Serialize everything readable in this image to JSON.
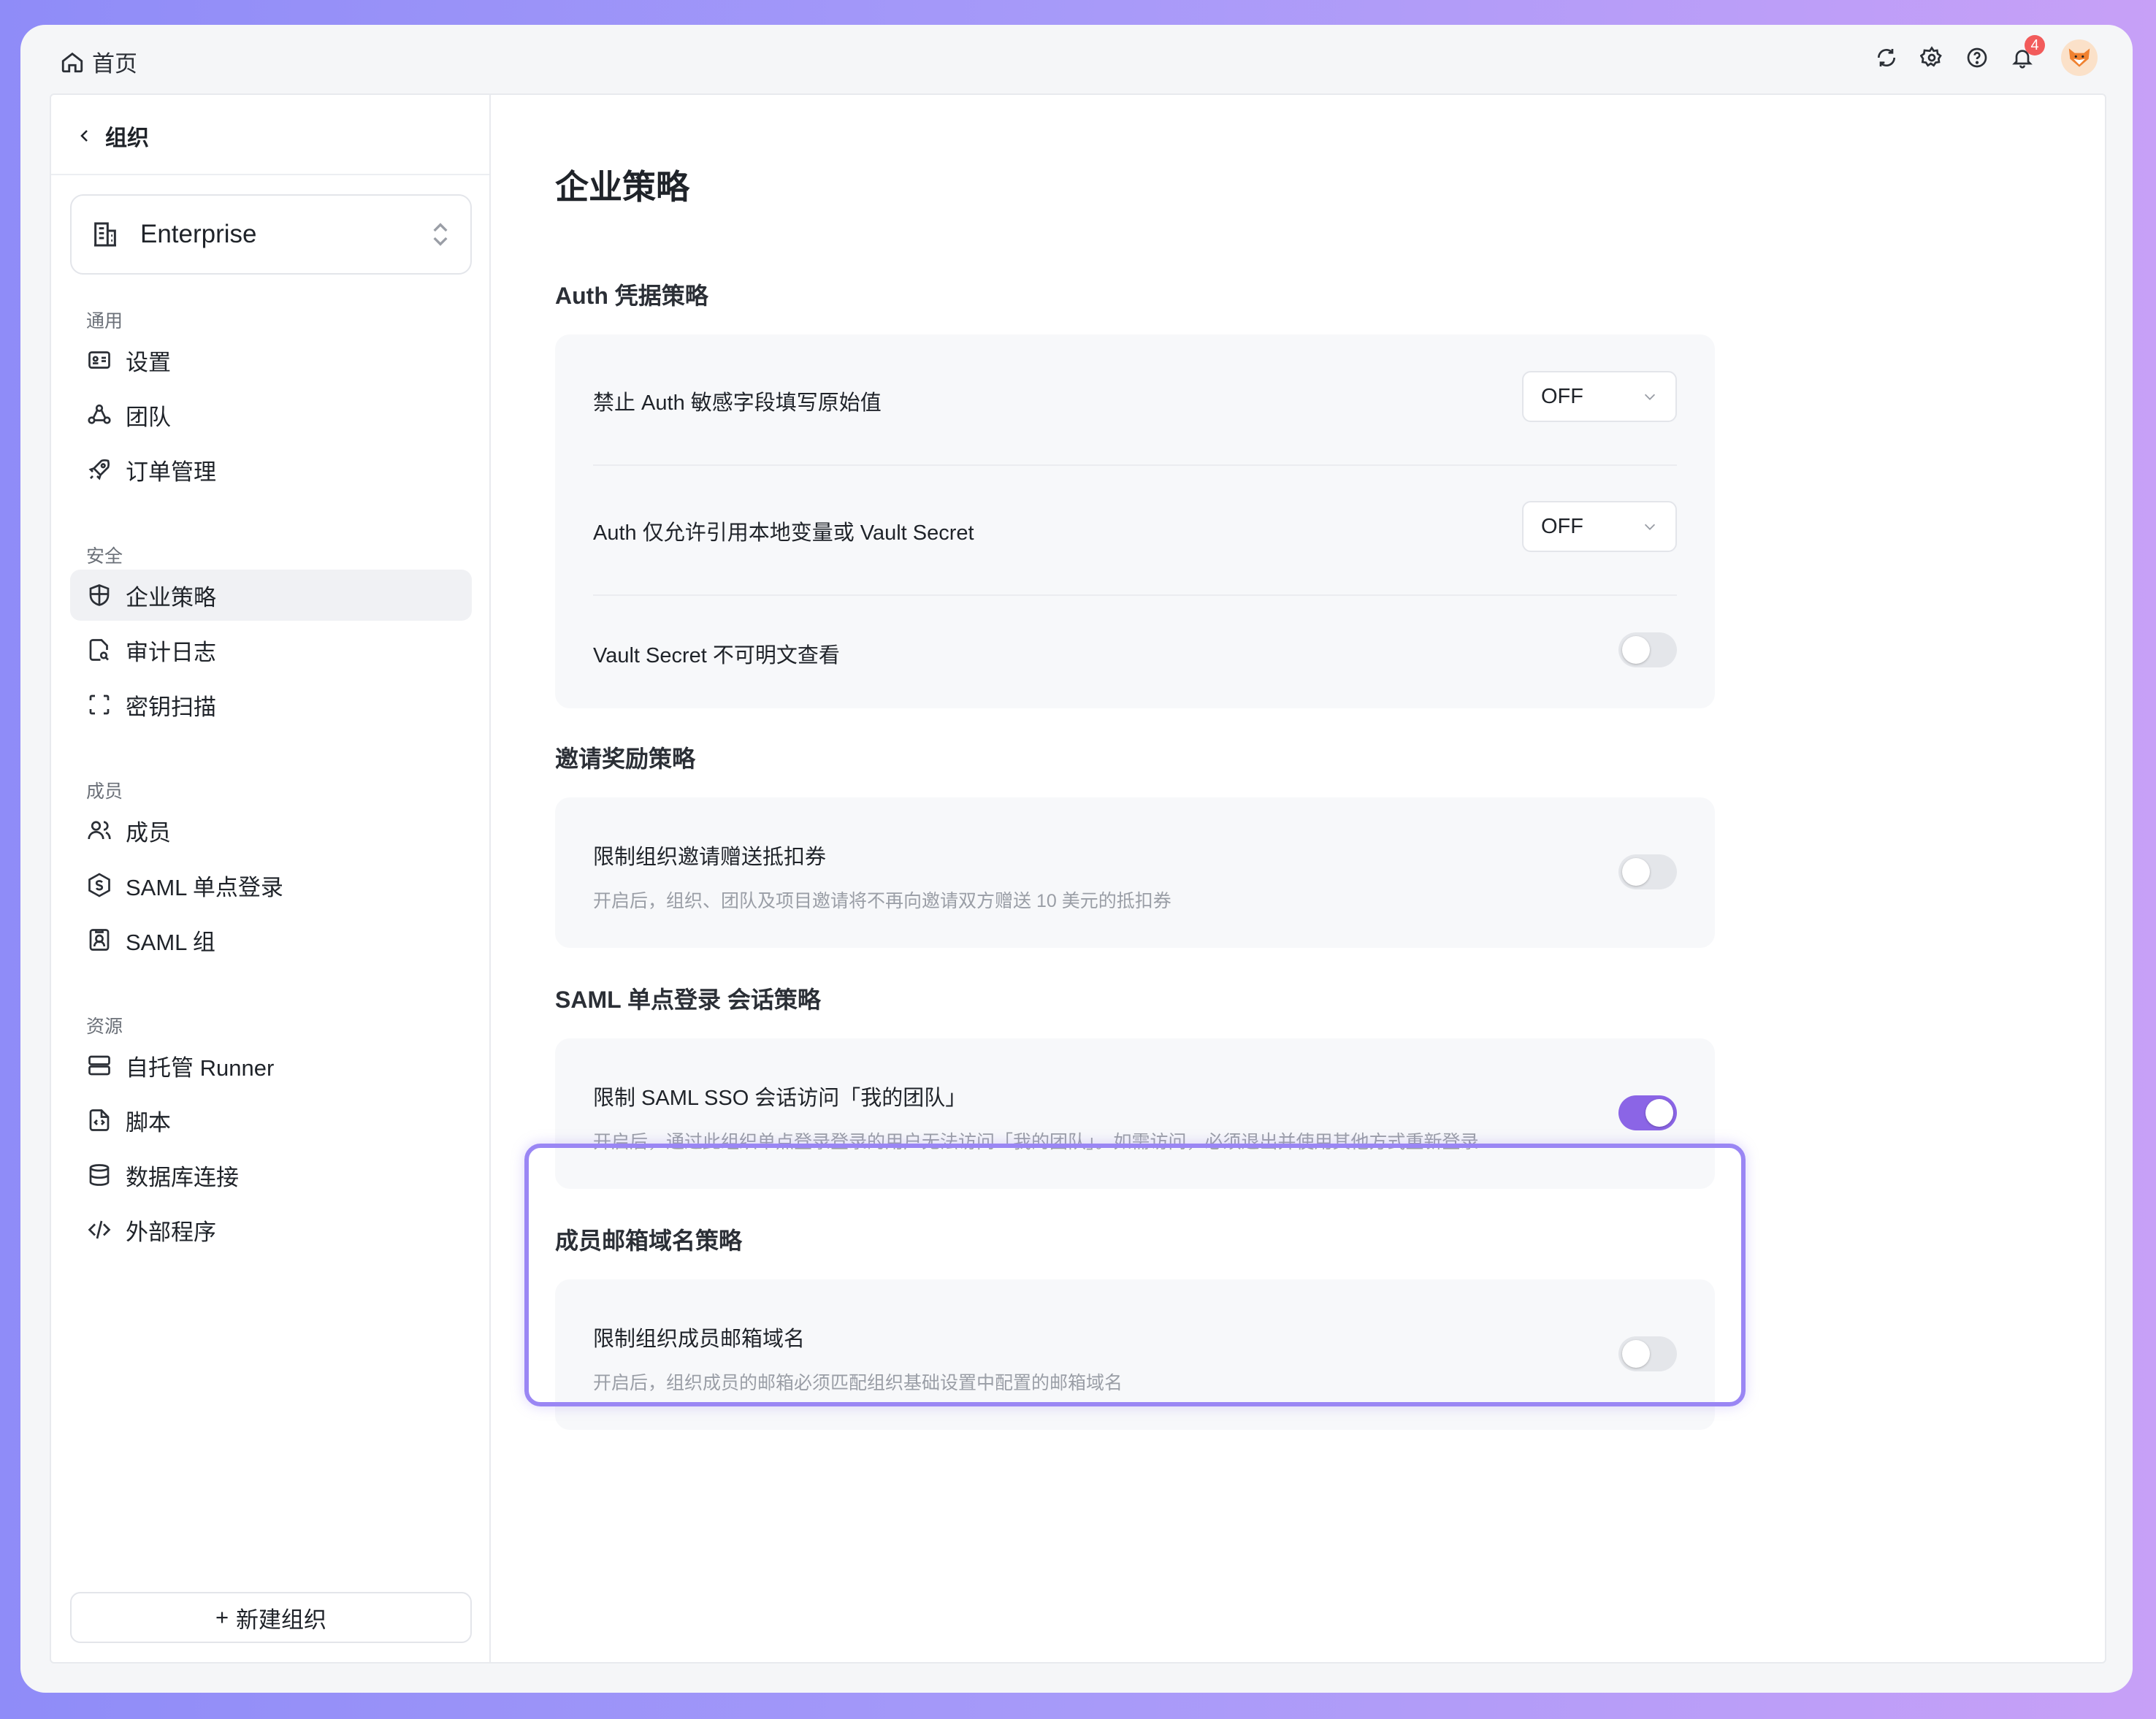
{
  "topbar": {
    "home_label": "首页",
    "notification_count": "4"
  },
  "sidebar": {
    "back_label": "组织",
    "org_name": "Enterprise",
    "sections": {
      "general": "通用",
      "security": "安全",
      "members": "成员",
      "resources": "资源"
    },
    "items": {
      "settings": "设置",
      "team": "团队",
      "orders": "订单管理",
      "policy": "企业策略",
      "audit": "审计日志",
      "secret_scan": "密钥扫描",
      "members": "成员",
      "saml_sso": "SAML 单点登录",
      "saml_group": "SAML 组",
      "runner": "自托管 Runner",
      "scripts": "脚本",
      "db": "数据库连接",
      "external": "外部程序"
    },
    "new_org": "新建组织"
  },
  "content": {
    "title": "企业策略",
    "auth": {
      "title": "Auth 凭据策略",
      "row1_label": "禁止 Auth 敏感字段填写原始值",
      "row1_value": "OFF",
      "row2_label": "Auth 仅允许引用本地变量或 Vault Secret",
      "row2_value": "OFF",
      "row3_label": "Vault Secret 不可明文查看",
      "row3_on": false
    },
    "invite": {
      "title": "邀请奖励策略",
      "label": "限制组织邀请赠送抵扣券",
      "desc": "开启后，组织、团队及项目邀请将不再向邀请双方赠送 10 美元的抵扣券",
      "on": false
    },
    "saml": {
      "title": "SAML 单点登录 会话策略",
      "label": "限制 SAML SSO 会话访问「我的团队」",
      "desc": "开启后，通过此组织单点登录登录的用户无法访问「我的团队」。如需访问，必须退出并使用其他方式重新登录",
      "on": true
    },
    "email": {
      "title": "成员邮箱域名策略",
      "label": "限制组织成员邮箱域名",
      "desc": "开启后，组织成员的邮箱必须匹配组织基础设置中配置的邮箱域名",
      "on": false
    }
  },
  "colors": {
    "accent": "#8b65e6",
    "highlight": "#9a86f4"
  }
}
